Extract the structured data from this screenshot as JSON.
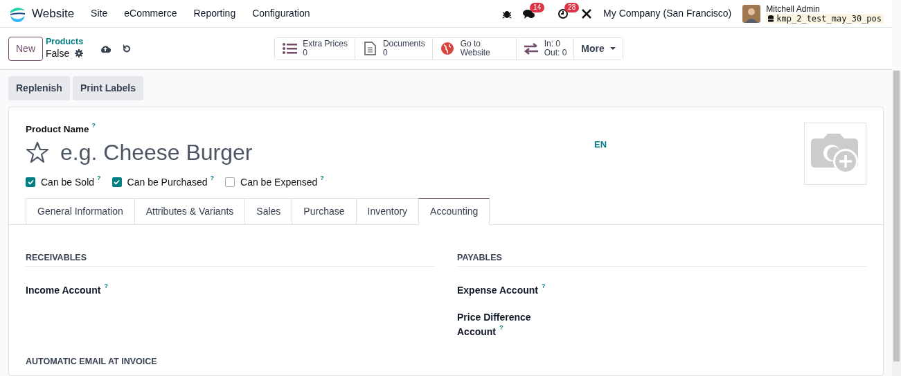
{
  "navbar": {
    "app": "Website",
    "menus": [
      "Site",
      "eCommerce",
      "Reporting",
      "Configuration"
    ],
    "messages_count": "14",
    "activities_count": "28",
    "company": "My Company (San Francisco)",
    "user": "Mitchell Admin",
    "database": "kmp_2_test_may_30_pos"
  },
  "control_panel": {
    "new_button": "New",
    "breadcrumb": "Products",
    "record": "False",
    "more": "More",
    "smart_buttons": [
      {
        "kind": "list",
        "label": "Extra Prices",
        "value": "0"
      },
      {
        "kind": "document",
        "label": "Documents",
        "value": "0"
      },
      {
        "kind": "globe",
        "label": "Go to Website"
      },
      {
        "kind": "transfer",
        "label": "In: 0",
        "value": "Out: 0"
      }
    ]
  },
  "actions": [
    "Replenish",
    "Print Labels"
  ],
  "form": {
    "name_label": "Product Name",
    "name_help": "?",
    "name_placeholder": "e.g. Cheese Burger",
    "favorite": false,
    "language": "EN",
    "checkboxes": [
      {
        "label": "Can be Sold",
        "help": "?",
        "checked": true
      },
      {
        "label": "Can be Purchased",
        "help": "?",
        "checked": true
      },
      {
        "label": "Can be Expensed",
        "help": "?",
        "checked": false
      }
    ],
    "tabs": [
      {
        "label": "General Information",
        "selected": false
      },
      {
        "label": "Attributes & Variants",
        "selected": false
      },
      {
        "label": "Sales",
        "selected": false
      },
      {
        "label": "Purchase",
        "selected": false
      },
      {
        "label": "Inventory",
        "selected": false
      },
      {
        "label": "Accounting",
        "selected": true
      }
    ],
    "sections": [
      {
        "title": "RECEIVABLES",
        "fields": [
          {
            "label": "Income Account",
            "help": "?"
          }
        ]
      },
      {
        "title": "PAYABLES",
        "fields": [
          {
            "label": "Expense Account",
            "help": "?"
          },
          {
            "label": "Price Difference Account",
            "help": "?"
          }
        ]
      }
    ],
    "next_section": "AUTOMATIC EMAIL AT INVOICE"
  }
}
